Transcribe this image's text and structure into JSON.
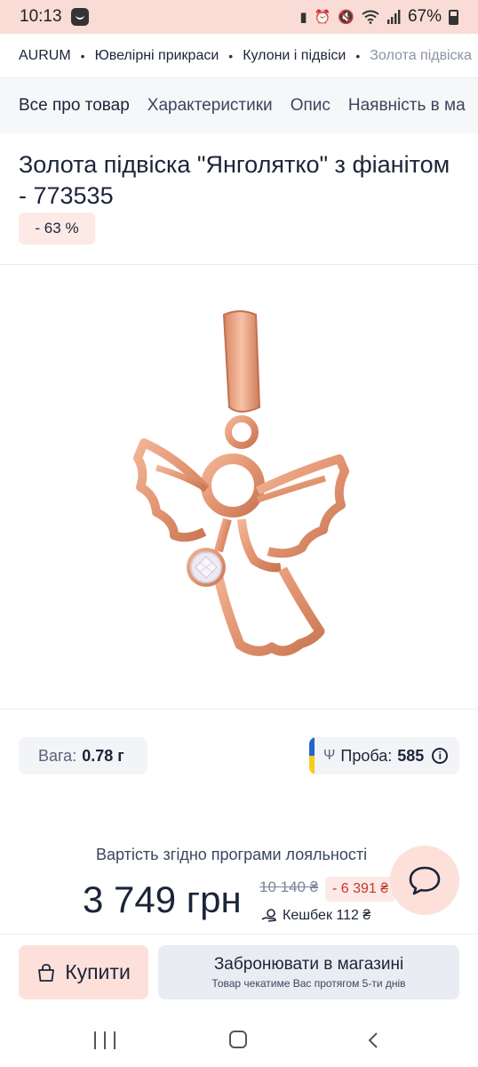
{
  "status_bar": {
    "time": "10:13",
    "battery": "67%",
    "icons": [
      "app-notification-icon",
      "battery-saver-icon",
      "alarm-icon",
      "mute-icon",
      "wifi-icon",
      "signal-icon",
      "battery-icon"
    ]
  },
  "breadcrumb": [
    "AURUM",
    "Ювелірні прикраси",
    "Кулони і підвіси",
    "Золота підвіска"
  ],
  "tabs": [
    "Все про товар",
    "Характеристики",
    "Опис",
    "Наявність в ма"
  ],
  "product": {
    "title": "Золота підвіска \"Янголятко\" з фіанітом - 773535",
    "discount": "- 63 %",
    "image_alt": "angel pendant"
  },
  "specs": {
    "weight_label": "Вага:",
    "weight_value": "0.78 г",
    "proba_label": "Проба:",
    "proba_value": "585"
  },
  "price": {
    "loyalty_label": "Вартість згідно програми лояльності",
    "current": "3 749 грн",
    "old": "10 140 ₴",
    "save": "- 6 391 ₴",
    "cashback": "Кешбек 112 ₴"
  },
  "actions": {
    "buy_label": "Купити",
    "reserve_label": "Забронювати в магазині",
    "reserve_sub": "Товар чекатиме Вас протягом 5-ти днів"
  },
  "colors": {
    "accent_pink": "#fde0da",
    "status_bar": "#f9dcd6",
    "text_dark": "#1b2438",
    "sale_red": "#c4382b",
    "gold": "#e9a07f"
  }
}
